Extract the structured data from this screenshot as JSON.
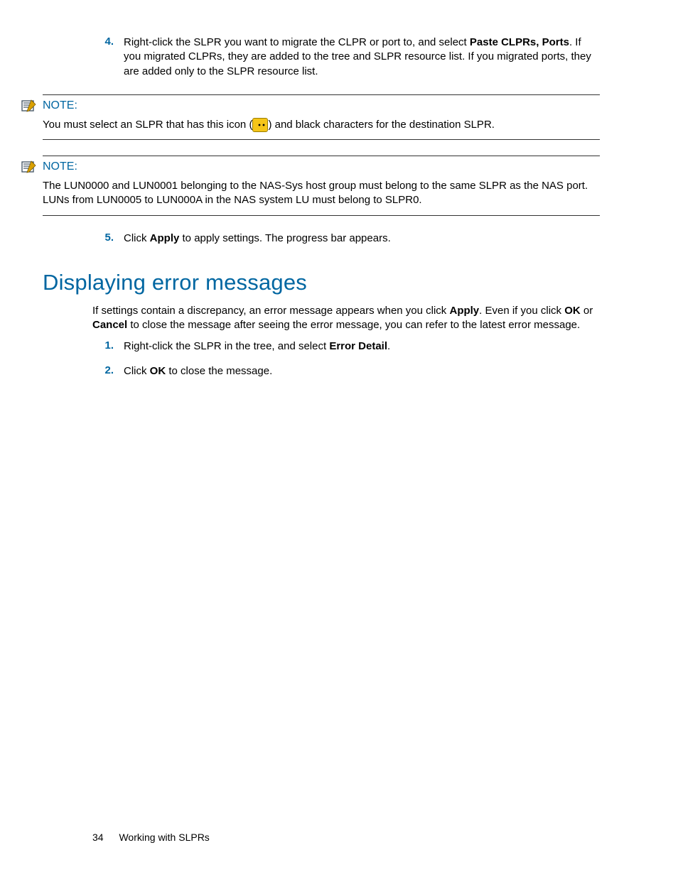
{
  "main_list": {
    "item4": {
      "num": "4.",
      "text_before": "Right-click the SLPR you want to migrate the CLPR or port to, and select ",
      "bold": "Paste CLPRs, Ports",
      "text_after": ". If you migrated CLPRs, they are added to the tree and SLPR resource list. If you migrated ports, they are added only to the SLPR resource list."
    },
    "item5": {
      "num": "5.",
      "text_before": "Click ",
      "bold": "Apply",
      "text_after": " to apply settings. The progress bar appears."
    }
  },
  "notes": {
    "label": "NOTE:",
    "note1": {
      "pre": "You must select an SLPR that has this icon (",
      "post": ") and black characters for the destination SLPR."
    },
    "note2": "The LUN0000 and LUN0001 belonging to the NAS-Sys host group must belong to the same SLPR as the NAS port. LUNs from LUN0005 to LUN000A in the NAS system LU must belong to SLPR0."
  },
  "section": {
    "heading": "Displaying error messages",
    "intro": {
      "p1a": "If settings contain a discrepancy, an error message appears when you click ",
      "p1b": "Apply",
      "p1c": ". Even if you click ",
      "p1d": "OK",
      "p1e": " or ",
      "p1f": "Cancel",
      "p1g": " to close the message after seeing the error message, you can refer to the latest error message."
    },
    "steps": {
      "s1": {
        "num": "1.",
        "pre": "Right-click the SLPR in the tree, and select ",
        "bold": "Error Detail",
        "post": "."
      },
      "s2": {
        "num": "2.",
        "pre": "Click ",
        "bold": "OK",
        "post": " to close the message."
      }
    }
  },
  "footer": {
    "page": "34",
    "title": "Working with SLPRs"
  }
}
